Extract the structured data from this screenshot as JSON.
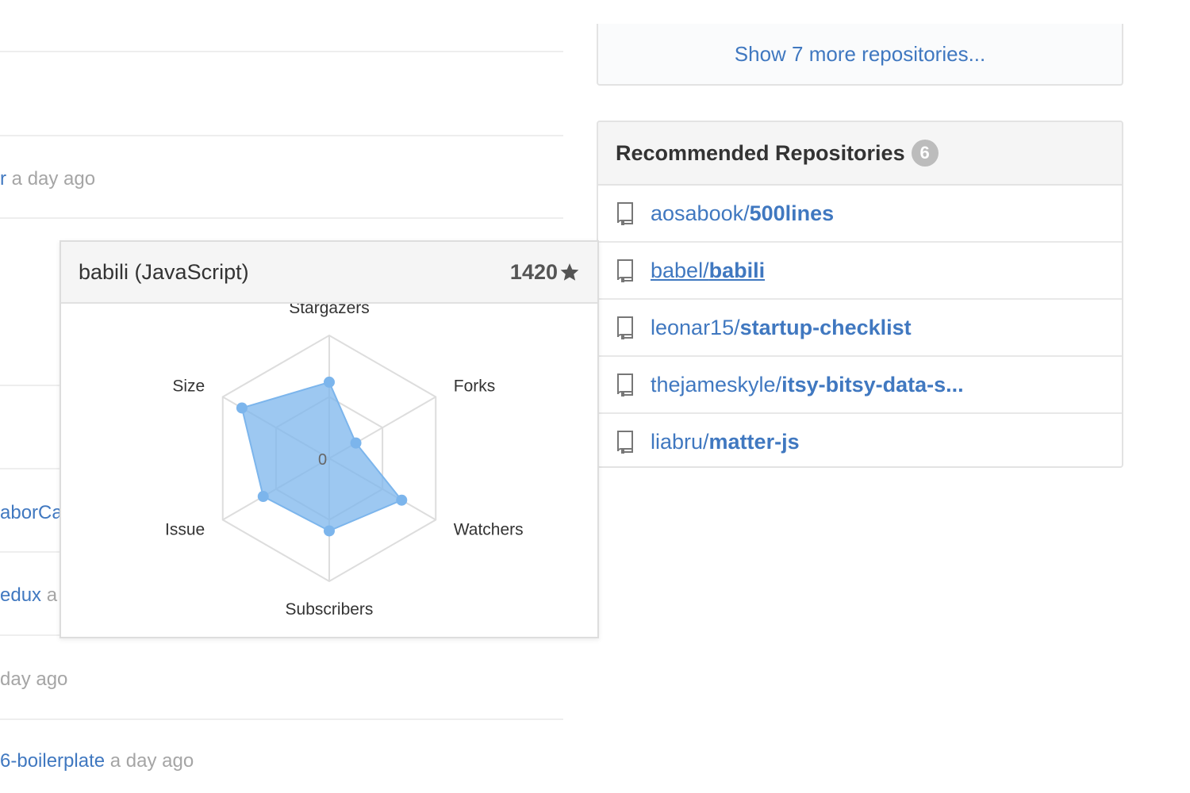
{
  "feed": {
    "fragments": [
      {
        "link": "r",
        "time": "a day ago"
      },
      {
        "link": "aborCa",
        "time": ""
      },
      {
        "link": "edux",
        "time": "a"
      },
      {
        "link": "",
        "time": "day ago"
      },
      {
        "link": "6-boilerplate",
        "time": "a day ago"
      }
    ]
  },
  "show_more": {
    "label": "Show 7 more repositories..."
  },
  "recommended": {
    "title": "Recommended Repositories",
    "count": "6",
    "items": [
      {
        "owner": "aosabook/",
        "name": "500lines"
      },
      {
        "owner": "babel/",
        "name": "babili"
      },
      {
        "owner": "leonar15/",
        "name": "startup-checklist"
      },
      {
        "owner": "thejameskyle/",
        "name": "itsy-bitsy-data-s..."
      },
      {
        "owner": "liabru/",
        "name": "matter-js"
      }
    ]
  },
  "popover": {
    "title": "babili (JavaScript)",
    "stars": "1420"
  },
  "chart_data": {
    "type": "radar",
    "axes": [
      "Stargazers",
      "Forks",
      "Watchers",
      "Subscribers",
      "Issue",
      "Size"
    ],
    "center_label": "0",
    "values": [
      0.62,
      0.25,
      0.68,
      0.59,
      0.62,
      0.82
    ],
    "max": 1,
    "grid_levels": 2,
    "series_color": "#7cb5ec"
  },
  "colors": {
    "link": "#4078c0",
    "muted": "#a5a5a5",
    "badge": "#bcbcbc",
    "accent": "#7cb5ec"
  }
}
